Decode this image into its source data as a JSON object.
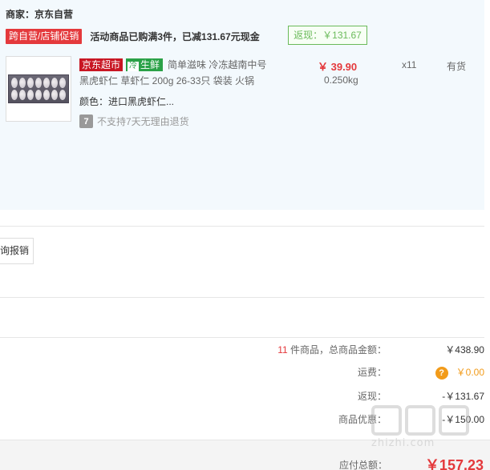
{
  "seller": {
    "label": "商家：京东自营"
  },
  "promotion": {
    "tag": "跨自营/店铺促销",
    "text": "活动商品已购满3件，已减131.67元现金",
    "cashback": "返现：￥131.67"
  },
  "product": {
    "tag_store": "京东超市",
    "tag_fresh_icon": "冷",
    "tag_fresh": "生鲜",
    "title": "简单滋味 冷冻越南中号黑虎虾仁 草虾仁 200g 26-33只 袋装 火锅",
    "color": "颜色：进口黑虎虾仁...",
    "return_icon": "7",
    "return_policy": "不支持7天无理由退货",
    "price": "￥ 39.90",
    "weight": "0.250kg",
    "quantity": "x11",
    "stock": "有货"
  },
  "invoice": {
    "button_label": "询报销"
  },
  "summary": {
    "count": "11",
    "count_suffix": " 件商品，总商品金额：",
    "goods_total": "￥438.90",
    "freight_label": "运费：",
    "freight_icon": "?",
    "freight_value": "￥0.00",
    "cashback_label": "返现：",
    "cashback_value": "-￥131.67",
    "discount_label": "商品优惠：",
    "discount_value": "-￥150.00"
  },
  "total": {
    "label": "应付总额：",
    "value": "￥157.23"
  },
  "watermark": {
    "text": "zhizhi.com"
  },
  "colors": {
    "accent_red": "#e4393c",
    "fresh_green": "#2aa147",
    "cashback_green": "#6aba5a",
    "freight_orange": "#f29b1a"
  }
}
